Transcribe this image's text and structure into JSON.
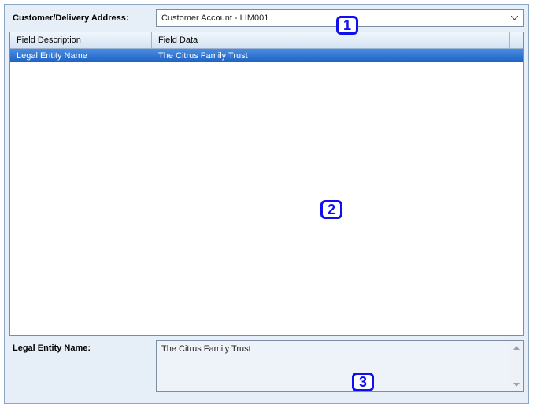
{
  "header": {
    "address_label": "Customer/Delivery Address:",
    "address_value": "Customer Account - LIM001"
  },
  "table": {
    "columns": {
      "desc": "Field Description",
      "data": "Field Data"
    },
    "rows": [
      {
        "desc": "Legal Entity Name",
        "data": "The Citrus Family Trust"
      }
    ]
  },
  "detail": {
    "label": "Legal Entity Name:",
    "value": "The Citrus Family Trust"
  },
  "badges": {
    "one": "1",
    "two": "2",
    "three": "3"
  }
}
